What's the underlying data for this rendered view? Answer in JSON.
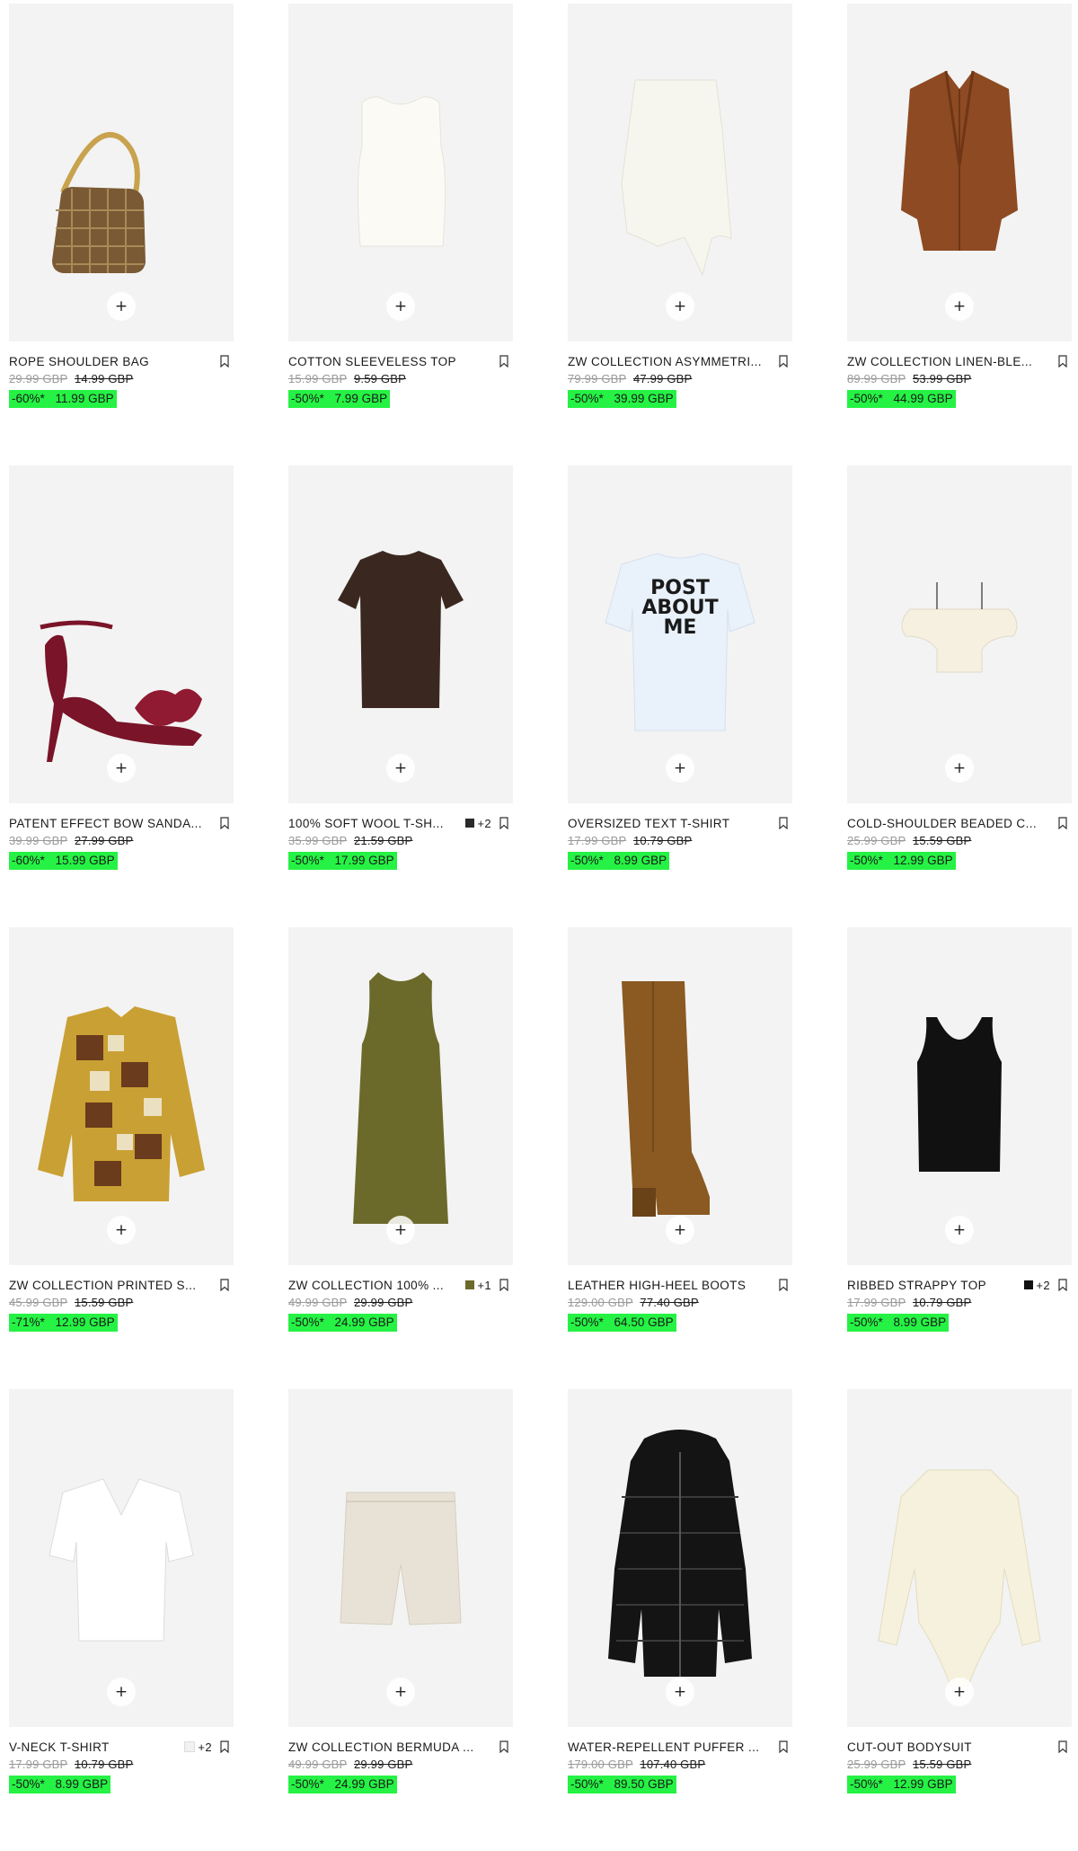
{
  "colors": {
    "sale_badge": "#25f244",
    "card_bg": "#f3f3f3"
  },
  "add_icon": "+",
  "products": [
    {
      "name": "ROPE SHOULDER BAG",
      "original_price": "29.99 GBP",
      "previous_price": "14.99 GBP",
      "discount": "-60%*",
      "sale_price": "11.99 GBP",
      "image": "rope-bag"
    },
    {
      "name": "COTTON SLEEVELESS TOP",
      "original_price": "15.99 GBP",
      "previous_price": "9.59 GBP",
      "discount": "-50%*",
      "sale_price": "7.99 GBP",
      "image": "white-tank"
    },
    {
      "name": "ZW COLLECTION ASYMMETRI...",
      "original_price": "79.99 GBP",
      "previous_price": "47.99 GBP",
      "discount": "-50%*",
      "sale_price": "39.99 GBP",
      "image": "white-skirt"
    },
    {
      "name": "ZW COLLECTION LINEN-BLE...",
      "original_price": "89.99 GBP",
      "previous_price": "53.99 GBP",
      "discount": "-50%*",
      "sale_price": "44.99 GBP",
      "image": "brown-blazer"
    },
    {
      "name": "PATENT EFFECT BOW SANDA...",
      "original_price": "39.99 GBP",
      "previous_price": "27.99 GBP",
      "discount": "-60%*",
      "sale_price": "15.99 GBP",
      "image": "bow-sandal"
    },
    {
      "name": "100% SOFT WOOL T-SH...",
      "swatch_color": "#2a2a2a",
      "swatch_label": "+2",
      "original_price": "35.99 GBP",
      "previous_price": "21.59 GBP",
      "discount": "-50%*",
      "sale_price": "17.99 GBP",
      "image": "brown-tee"
    },
    {
      "name": "OVERSIZED TEXT T-SHIRT",
      "original_price": "17.99 GBP",
      "previous_price": "10.79 GBP",
      "discount": "-50%*",
      "sale_price": "8.99 GBP",
      "image": "text-tee",
      "print_lines": [
        "POST",
        "ABOUT",
        "ME"
      ]
    },
    {
      "name": "COLD-SHOULDER BEADED C...",
      "original_price": "25.99 GBP",
      "previous_price": "15.59 GBP",
      "discount": "-50%*",
      "sale_price": "12.99 GBP",
      "image": "ruffle-top"
    },
    {
      "name": "ZW COLLECTION PRINTED S...",
      "original_price": "45.99 GBP",
      "previous_price": "15.59 GBP",
      "discount": "-71%*",
      "sale_price": "12.99 GBP",
      "image": "printed-shirt"
    },
    {
      "name": "ZW COLLECTION 100% ...",
      "swatch_color": "#6b6a2a",
      "swatch_label": "+1",
      "original_price": "49.99 GBP",
      "previous_price": "29.99 GBP",
      "discount": "-50%*",
      "sale_price": "24.99 GBP",
      "image": "olive-dress"
    },
    {
      "name": "LEATHER HIGH-HEEL BOOTS",
      "original_price": "129.00 GBP",
      "previous_price": "77.40 GBP",
      "discount": "-50%*",
      "sale_price": "64.50 GBP",
      "image": "tan-boot"
    },
    {
      "name": "RIBBED STRAPPY TOP",
      "swatch_color": "#111111",
      "swatch_label": "+2",
      "original_price": "17.99 GBP",
      "previous_price": "10.79 GBP",
      "discount": "-50%*",
      "sale_price": "8.99 GBP",
      "image": "black-tank"
    },
    {
      "name": "V-NECK T-SHIRT",
      "swatch_color": "#f2f2f2",
      "swatch_label": "+2",
      "original_price": "17.99 GBP",
      "previous_price": "10.79 GBP",
      "discount": "-50%*",
      "sale_price": "8.99 GBP",
      "image": "white-tee"
    },
    {
      "name": "ZW COLLECTION BERMUDA ...",
      "original_price": "49.99 GBP",
      "previous_price": "29.99 GBP",
      "discount": "-50%*",
      "sale_price": "24.99 GBP",
      "image": "bermuda-shorts"
    },
    {
      "name": "WATER-REPELLENT PUFFER ...",
      "original_price": "179.00 GBP",
      "previous_price": "107.40 GBP",
      "discount": "-50%*",
      "sale_price": "89.50 GBP",
      "image": "puffer-coat"
    },
    {
      "name": "CUT-OUT BODYSUIT",
      "original_price": "25.99 GBP",
      "previous_price": "15.59 GBP",
      "discount": "-50%*",
      "sale_price": "12.99 GBP",
      "image": "bodysuit"
    }
  ]
}
